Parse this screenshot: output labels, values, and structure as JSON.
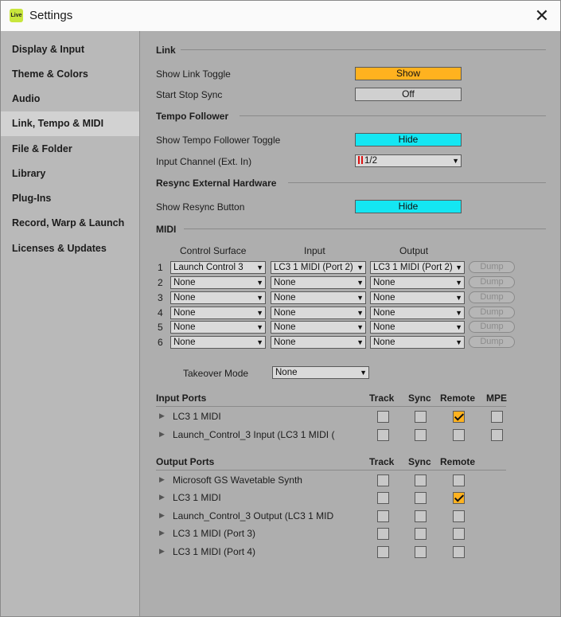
{
  "window": {
    "title": "Settings",
    "app_icon_text": "Live",
    "close_glyph": "✕"
  },
  "sidebar": {
    "active_index": 3,
    "items": [
      {
        "label": "Display & Input"
      },
      {
        "label": "Theme & Colors"
      },
      {
        "label": "Audio"
      },
      {
        "label": "Link, Tempo & MIDI"
      },
      {
        "label": "File & Folder"
      },
      {
        "label": "Library"
      },
      {
        "label": "Plug-Ins"
      },
      {
        "label": "Record, Warp & Launch"
      },
      {
        "label": "Licenses & Updates"
      }
    ]
  },
  "link": {
    "title": "Link",
    "show_link_toggle_label": "Show Link Toggle",
    "show_link_toggle_value": "Show",
    "start_stop_sync_label": "Start Stop Sync",
    "start_stop_sync_value": "Off"
  },
  "tempo_follower": {
    "title": "Tempo Follower",
    "show_toggle_label": "Show Tempo Follower Toggle",
    "show_toggle_value": "Hide",
    "input_channel_label": "Input Channel (Ext. In)",
    "input_channel_value": "1/2"
  },
  "resync": {
    "title": "Resync External Hardware",
    "show_button_label": "Show Resync Button",
    "show_button_value": "Hide"
  },
  "midi": {
    "title": "MIDI",
    "col_control_surface": "Control Surface",
    "col_input": "Input",
    "col_output": "Output",
    "dump_label": "Dump",
    "rows": [
      {
        "num": "1",
        "surface": "Launch Control 3",
        "input": "LC3 1 MIDI (Port 2)",
        "output": "LC3 1 MIDI (Port 2)"
      },
      {
        "num": "2",
        "surface": "None",
        "input": "None",
        "output": "None"
      },
      {
        "num": "3",
        "surface": "None",
        "input": "None",
        "output": "None"
      },
      {
        "num": "4",
        "surface": "None",
        "input": "None",
        "output": "None"
      },
      {
        "num": "5",
        "surface": "None",
        "input": "None",
        "output": "None"
      },
      {
        "num": "6",
        "surface": "None",
        "input": "None",
        "output": "None"
      }
    ],
    "takeover_label": "Takeover Mode",
    "takeover_value": "None"
  },
  "input_ports": {
    "title": "Input Ports",
    "col_track": "Track",
    "col_sync": "Sync",
    "col_remote": "Remote",
    "col_mpe": "MPE",
    "rows": [
      {
        "name": "LC3 1 MIDI",
        "track": false,
        "sync": false,
        "remote": true,
        "mpe": false
      },
      {
        "name": "Launch_Control_3 Input (LC3 1 MIDI (",
        "track": false,
        "sync": false,
        "remote": false,
        "mpe": false
      }
    ]
  },
  "output_ports": {
    "title": "Output Ports",
    "col_track": "Track",
    "col_sync": "Sync",
    "col_remote": "Remote",
    "rows": [
      {
        "name": "Microsoft GS Wavetable Synth",
        "track": false,
        "sync": false,
        "remote": false
      },
      {
        "name": "LC3 1 MIDI",
        "track": false,
        "sync": false,
        "remote": true
      },
      {
        "name": "Launch_Control_3 Output (LC3 1 MID",
        "track": false,
        "sync": false,
        "remote": false
      },
      {
        "name": "LC3 1 MIDI (Port 3)",
        "track": false,
        "sync": false,
        "remote": false
      },
      {
        "name": "LC3 1 MIDI (Port 4)",
        "track": false,
        "sync": false,
        "remote": false
      }
    ]
  },
  "colors": {
    "accent_orange": "#ffb21f",
    "accent_cyan": "#14e6f2",
    "panel_gray": "#aeaeae"
  },
  "icons": {
    "dropdown": "chevron-down-icon",
    "expand": "triangle-right-icon",
    "check": "checkmark-icon"
  }
}
